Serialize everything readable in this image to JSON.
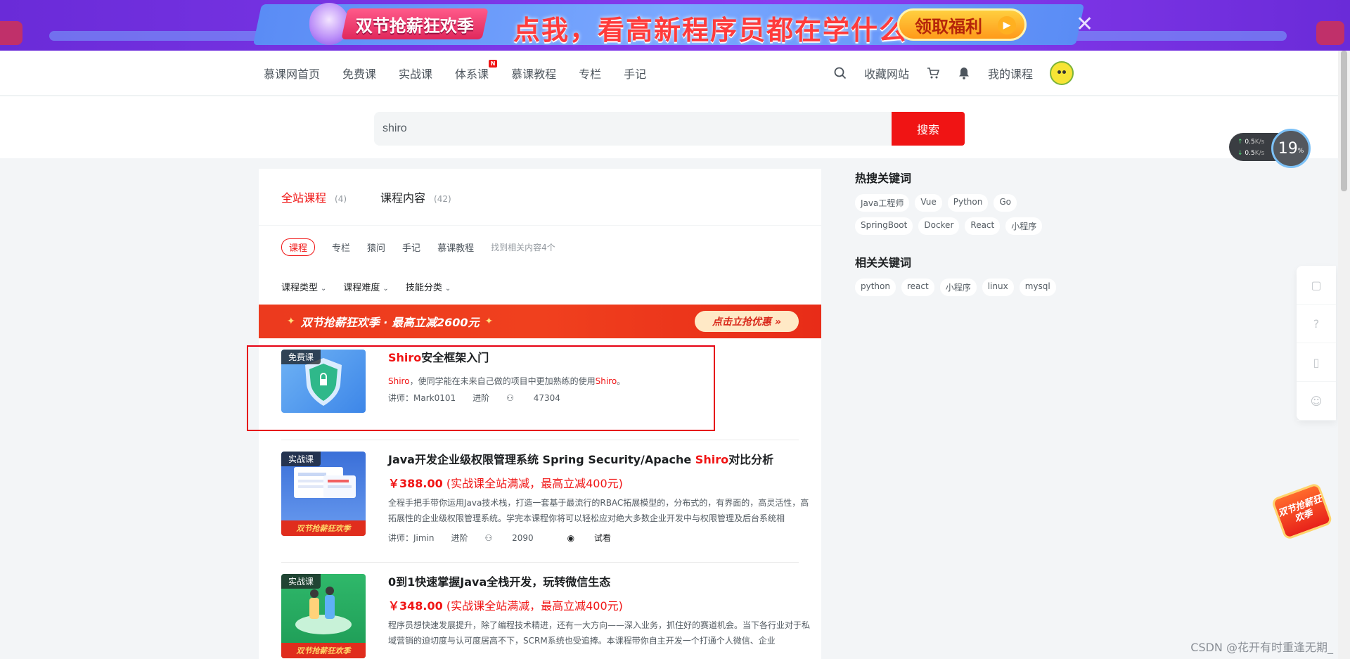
{
  "banner": {
    "pill_text": "双节抢薪狂欢季",
    "headline": "点我，看高新程序员都在学什么",
    "cta_label": "领取福利",
    "close_glyph": "✕"
  },
  "nav": {
    "items": [
      {
        "label": "慕课网首页"
      },
      {
        "label": "免费课"
      },
      {
        "label": "实战课"
      },
      {
        "label": "体系课",
        "badge": "N"
      },
      {
        "label": "慕课教程"
      },
      {
        "label": "专栏"
      },
      {
        "label": "手记"
      }
    ],
    "right": {
      "favorites": "收藏网站",
      "my_courses": "我的课程"
    }
  },
  "search": {
    "value": "shiro",
    "button_label": "搜索"
  },
  "tabs": [
    {
      "label": "全站课程",
      "count": "(4)"
    },
    {
      "label": "课程内容",
      "count": "(42)"
    }
  ],
  "subtabs": {
    "items": [
      "课程",
      "专栏",
      "猿问",
      "手记",
      "慕课教程"
    ],
    "found_text": "找到相关内容4个"
  },
  "filters": [
    "课程类型",
    "课程难度",
    "技能分类"
  ],
  "promo": {
    "text": "双节抢薪狂欢季 · 最高立减2600元",
    "button": "点击立抢优惠 »"
  },
  "courses": [
    {
      "tag": "免费课",
      "title_hl": "Shiro",
      "title_rest": "安全框架入门",
      "desc_hl": "Shiro",
      "desc_mid": "，使同学能在未来自己做的项目中更加熟练的使用",
      "desc_hl2": "Shiro",
      "desc_end": "。",
      "teacher": "讲师：Mark0101",
      "level": "进阶",
      "students": "47304"
    },
    {
      "tag": "实战课",
      "thumb_promo": "双节抢薪狂欢季",
      "title_pre": "Java开发企业级权限管理系统 Spring Security/Apache ",
      "title_hl": "Shiro",
      "title_post": "对比分析",
      "price": "￥388.00",
      "price_note": "(实战课全站满减，最高立减400元)",
      "desc": "全程手把手带你运用Java技术栈，打造一套基于最流行的RBAC拓展模型的，分布式的，有界面的，高灵活性，高拓展性的企业级权限管理系统。学完本课程你将可以轻松应对绝大多数企业开发中与权限管理及后台系统相",
      "teacher": "讲师：Jimin",
      "level": "进阶",
      "students": "2090",
      "trial": "试看"
    },
    {
      "tag": "实战课",
      "thumb_promo": "双节抢薪狂欢季",
      "title": "0到1快速掌握Java全栈开发，玩转微信生态",
      "price": "￥348.00",
      "price_note": "(实战课全站满减，最高立减400元)",
      "desc": "程序员想快速发展提升，除了编程技术精进，还有一大方向——深入业务，抓住好的赛道机会。当下各行业对于私域营销的迫切度与认可度居高不下，SCRM系统也受追捧。本课程带你自主开发一个打通个人微信、企业"
    }
  ],
  "sidebar": {
    "hot_title": "热搜关键词",
    "hot": [
      "Java工程师",
      "Vue",
      "Python",
      "Go",
      "SpringBoot",
      "Docker",
      "React",
      "小程序"
    ],
    "related_title": "相关关键词",
    "related": [
      "python",
      "react",
      "小程序",
      "linux",
      "mysql"
    ]
  },
  "net_widget": {
    "up": "0.5",
    "down": "0.5",
    "unit": "K/s",
    "percent": "19",
    "percent_unit": "%"
  },
  "float_badge": "双节抢薪狂欢季",
  "watermark": "CSDN @花开有时重逢无期_"
}
